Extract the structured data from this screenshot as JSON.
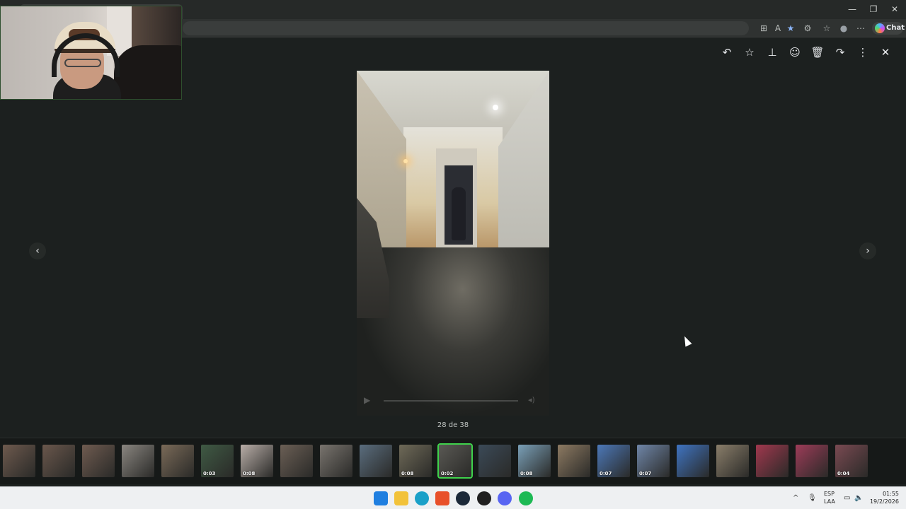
{
  "browser": {
    "window_controls": {
      "minimize": "—",
      "restore": "❐",
      "close": "✕"
    },
    "toolbar_icons": [
      "app-icon",
      "read-aloud-icon",
      "favorite-star-icon",
      "extensions-icon",
      "favorites-icon",
      "profile-icon",
      "more-icon"
    ],
    "toolbar_glyphs": {
      "app": "⊞",
      "read": "A",
      "fav": "★",
      "ext": "⚙",
      "favs": "☆",
      "profile": "●",
      "more": "⋯"
    },
    "chat_label": "Chat"
  },
  "viewer": {
    "actions": [
      {
        "name": "reply-icon",
        "glyph": "↶"
      },
      {
        "name": "star-icon",
        "glyph": "☆"
      },
      {
        "name": "pin-icon",
        "glyph": "⊥"
      },
      {
        "name": "emoji-icon",
        "glyph": "☺"
      },
      {
        "name": "delete-icon",
        "glyph": "🗑"
      },
      {
        "name": "forward-icon",
        "glyph": "↷"
      },
      {
        "name": "menu-icon",
        "glyph": "⋮"
      }
    ],
    "close_glyph": "✕",
    "prev_glyph": "‹",
    "next_glyph": "›",
    "counter": "28 de 38",
    "player": {
      "play_glyph": "▶",
      "volume_glyph": "◂)"
    }
  },
  "filmstrip": {
    "thumbs": [
      {
        "duration": "",
        "color": "#6e5a4e"
      },
      {
        "duration": "",
        "color": "#6a574c"
      },
      {
        "duration": "",
        "color": "#6f5b50"
      },
      {
        "duration": "",
        "color": "#8a8680"
      },
      {
        "duration": "",
        "color": "#7a6a58"
      },
      {
        "duration": "0:03",
        "color": "#3f5a44"
      },
      {
        "duration": "0:08",
        "color": "#b9aea8"
      },
      {
        "duration": "",
        "color": "#6b5f55"
      },
      {
        "duration": "",
        "color": "#79746e"
      },
      {
        "duration": "",
        "color": "#5a6d7e"
      },
      {
        "duration": "0:08",
        "color": "#6f6a58"
      },
      {
        "duration": "0:02",
        "color": "#5a5954",
        "selected": true
      },
      {
        "duration": "",
        "color": "#3b4a58"
      },
      {
        "duration": "0:08",
        "color": "#7aa0b8"
      },
      {
        "duration": "",
        "color": "#8d7a62"
      },
      {
        "duration": "0:07",
        "color": "#4c78b8"
      },
      {
        "duration": "0:07",
        "color": "#6f86a8"
      },
      {
        "duration": "",
        "color": "#3f74c2"
      },
      {
        "duration": "",
        "color": "#8a7e6a"
      },
      {
        "duration": "",
        "color": "#a1384e"
      },
      {
        "duration": "",
        "color": "#9d3c58"
      },
      {
        "duration": "0:04",
        "color": "#7a4a52"
      }
    ]
  },
  "taskbar": {
    "apps": [
      {
        "name": "start-icon",
        "color": "#1f7fe0"
      },
      {
        "name": "file-explorer-icon",
        "color": "#f2c23a"
      },
      {
        "name": "edge-icon",
        "color": "#1aa0c8"
      },
      {
        "name": "brave-icon",
        "color": "#e8502a"
      },
      {
        "name": "steam-icon",
        "color": "#1b2838"
      },
      {
        "name": "app-icon",
        "color": "#202020"
      },
      {
        "name": "discord-icon",
        "color": "#5865f2"
      },
      {
        "name": "spotify-icon",
        "color": "#1db954"
      }
    ],
    "tray_chevron": "^",
    "mic_glyph": "🎙",
    "lang_top": "ESP",
    "lang_bottom": "LAA",
    "network_glyph": "▭",
    "volume_glyph": "🔈",
    "time": "01:55",
    "date": "19/2/2026"
  }
}
